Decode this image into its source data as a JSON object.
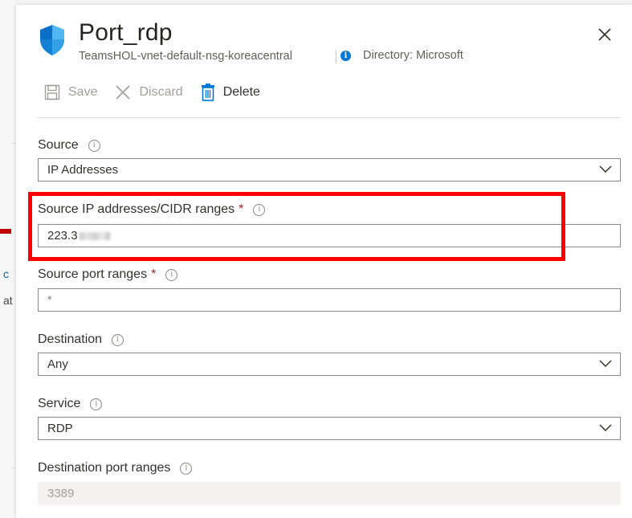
{
  "background": {
    "link_char": "c",
    "text_char": "at"
  },
  "header": {
    "title": "Port_rdp",
    "subtitle": "TeamsHOL-vnet-default-nsg-koreacentral",
    "directory": "Directory: Microsoft",
    "icon": "shield-icon",
    "close_icon": "close-icon"
  },
  "toolbar": {
    "save_label": "Save",
    "discard_label": "Discard",
    "delete_label": "Delete"
  },
  "form": {
    "source": {
      "label": "Source",
      "value": "IP Addresses"
    },
    "source_ip": {
      "label": "Source IP addresses/CIDR ranges",
      "required": "*",
      "value": "223.3"
    },
    "source_port": {
      "label": "Source port ranges",
      "required": "*",
      "value": "*"
    },
    "destination": {
      "label": "Destination",
      "value": "Any"
    },
    "service": {
      "label": "Service",
      "value": "RDP"
    },
    "dest_port": {
      "label": "Destination port ranges",
      "value": "3389"
    }
  },
  "colors": {
    "accent": "#0078d4",
    "highlight": "#ff0000",
    "required": "#a4262c"
  }
}
